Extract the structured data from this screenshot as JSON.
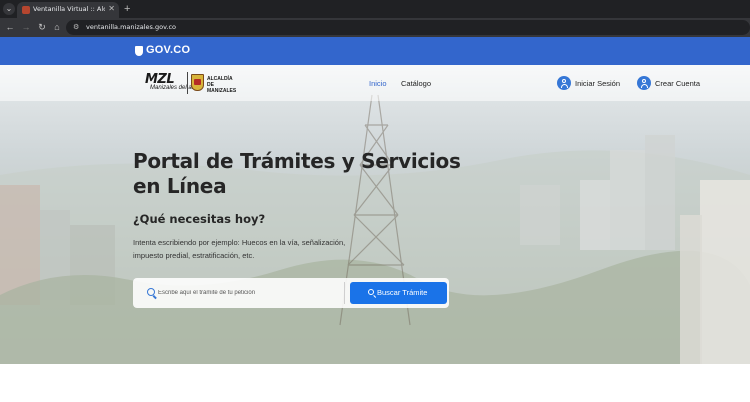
{
  "browser": {
    "tab_title": "Ventanilla Virtual :: Alcaldía de",
    "url": "ventanilla.manizales.gov.co"
  },
  "govbar": {
    "label": "GOV.CO"
  },
  "header": {
    "logo_text": "MZL",
    "logo_subtext": "Manizales del alma",
    "logo_alcaldia": "ALCALDÍA DE MANIZALES",
    "nav": [
      {
        "label": "Inicio",
        "active": true
      },
      {
        "label": "Catálogo",
        "active": false
      }
    ],
    "login_label": "Iniciar Sesión",
    "register_label": "Crear Cuenta"
  },
  "hero": {
    "title": "Portal de Trámites y Servicios en Línea",
    "subtitle": "¿Qué necesitas hoy?",
    "description": "Intenta escribiendo por ejemplo: Huecos en la vía, señalización, impuesto predial, estratificación, etc."
  },
  "search": {
    "placeholder": "Escribe aquí el trámite de tu petición",
    "button_label": "Buscar Trámite"
  },
  "colors": {
    "gov_blue": "#3366cc",
    "primary": "#1a73e8"
  }
}
